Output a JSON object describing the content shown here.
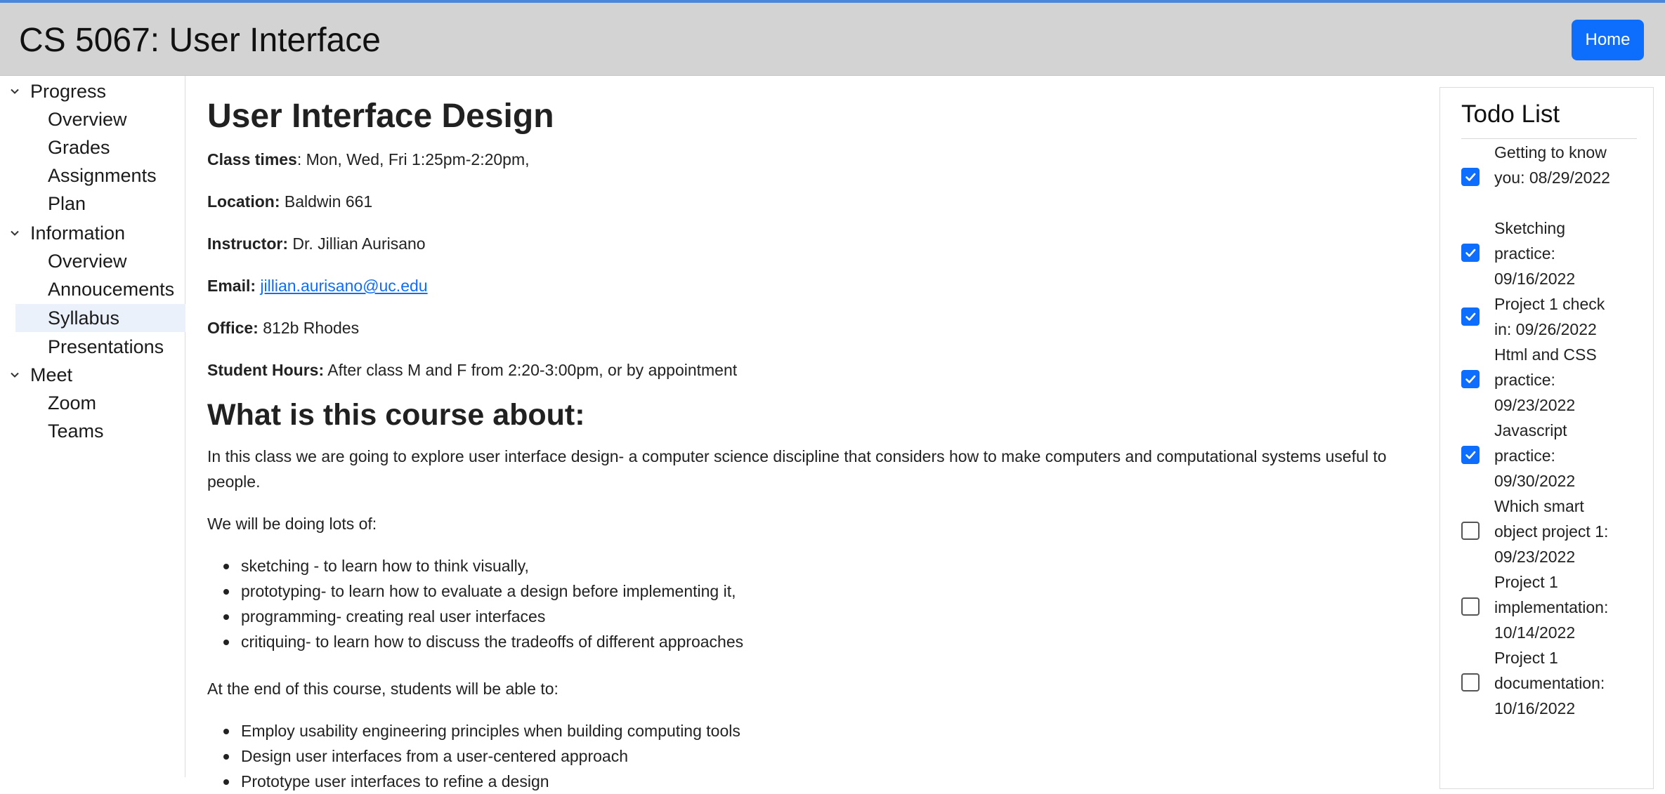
{
  "header": {
    "title": "CS 5067: User Interface",
    "home_label": "Home"
  },
  "sidebar": {
    "groups": [
      {
        "label": "Progress",
        "items": [
          {
            "label": "Overview"
          },
          {
            "label": "Grades"
          },
          {
            "label": "Assignments"
          },
          {
            "label": "Plan"
          }
        ]
      },
      {
        "label": "Information",
        "items": [
          {
            "label": "Overview"
          },
          {
            "label": "Annoucements"
          },
          {
            "label": "Syllabus",
            "selected": true
          },
          {
            "label": "Presentations"
          }
        ]
      },
      {
        "label": "Meet",
        "items": [
          {
            "label": "Zoom"
          },
          {
            "label": "Teams"
          }
        ]
      }
    ]
  },
  "main": {
    "title": "User Interface Design",
    "info": {
      "class_times_label": "Class times",
      "class_times_value": ": Mon, Wed, Fri 1:25pm-2:20pm,",
      "location_label": "Location:",
      "location_value": " Baldwin 661",
      "instructor_label": "Instructor:",
      "instructor_value": " Dr. Jillian Aurisano",
      "email_label": "Email:",
      "email_value": "jillian.aurisano@uc.edu",
      "office_label": "Office:",
      "office_value": " 812b Rhodes",
      "hours_label": "Student Hours:",
      "hours_value": " After class M and F from 2:20-3:00pm, or by appointment"
    },
    "about_heading": "What is this course about:",
    "about_paragraph": "In this class we are going to explore user interface design- a computer science discipline that considers how to make computers and computational systems useful to people.",
    "doing_intro": "We will be doing lots of:",
    "doing_list": [
      "sketching - to learn how to think visually,",
      "prototyping- to learn how to evaluate a design before implementing it,",
      "programming- creating real user interfaces",
      "critiquing- to learn how to discuss the tradeoffs of different approaches"
    ],
    "outcomes_intro": "At the end of this course, students will be able to:",
    "outcomes_list": [
      "Employ usability engineering principles when building computing tools",
      "Design user interfaces from a user-centered approach",
      "Prototype user interfaces to refine a design"
    ]
  },
  "todo": {
    "title": "Todo List",
    "items": [
      {
        "text": "Getting to know you: 08/29/2022",
        "checked": true
      },
      {
        "text": "Sketching practice: 09/16/2022",
        "checked": true
      },
      {
        "text": "Project 1 check in: 09/26/2022",
        "checked": true
      },
      {
        "text": "Html and CSS practice: 09/23/2022",
        "checked": true
      },
      {
        "text": "Javascript practice: 09/30/2022",
        "checked": true
      },
      {
        "text": "Which smart object project 1: 09/23/2022",
        "checked": false
      },
      {
        "text": "Project 1 implementation: 10/14/2022",
        "checked": false
      },
      {
        "text": "Project 1 documentation: 10/16/2022",
        "checked": false
      }
    ]
  },
  "colors": {
    "accent": "#0d6efd",
    "header_bg": "#d3d3d3",
    "selected_bg": "#ebf1fb"
  }
}
